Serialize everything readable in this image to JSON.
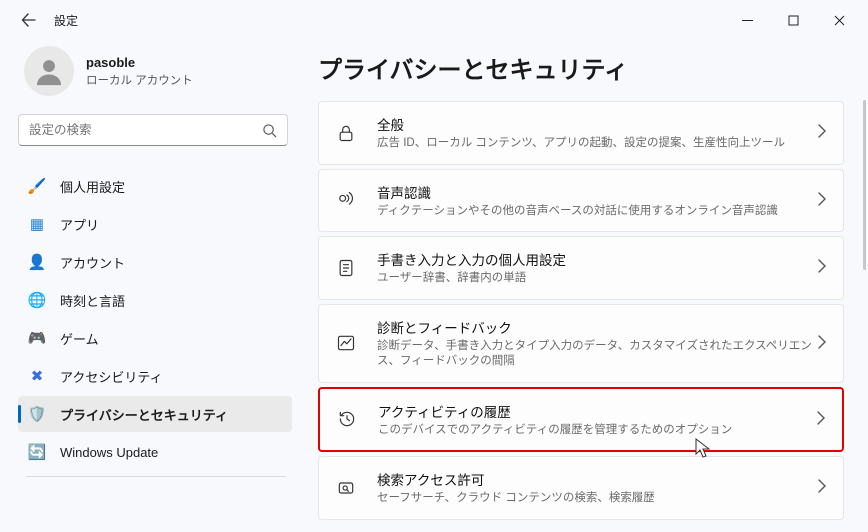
{
  "window": {
    "title": "設定"
  },
  "user": {
    "name": "pasoble",
    "type": "ローカル アカウント"
  },
  "search": {
    "placeholder": "設定の検索"
  },
  "nav": [
    {
      "icon": "🖌️",
      "label": "個人用設定"
    },
    {
      "icon": "▦",
      "label": "アプリ"
    },
    {
      "icon": "👤",
      "label": "アカウント"
    },
    {
      "icon": "🌐",
      "label": "時刻と言語"
    },
    {
      "icon": "🎮",
      "label": "ゲーム"
    },
    {
      "icon": "✖",
      "label": "アクセシビリティ"
    },
    {
      "icon": "🛡️",
      "label": "プライバシーとセキュリティ"
    },
    {
      "icon": "🔄",
      "label": "Windows Update"
    }
  ],
  "page": {
    "heading": "プライバシーとセキュリティ"
  },
  "items": [
    {
      "icon": "lock",
      "title": "全般",
      "desc": "広告 ID、ローカル コンテンツ、アプリの起動、設定の提案、生産性向上ツール"
    },
    {
      "icon": "voice",
      "title": "音声認識",
      "desc": "ディクテーションやその他の音声ベースの対話に使用するオンライン音声認識"
    },
    {
      "icon": "note",
      "title": "手書き入力と入力の個人用設定",
      "desc": "ユーザー辞書、辞書内の単語"
    },
    {
      "icon": "chart",
      "title": "診断とフィードバック",
      "desc": "診断データ、手書き入力とタイプ入力のデータ、カスタマイズされたエクスペリエンス、フィードバックの間隔"
    },
    {
      "icon": "history",
      "title": "アクティビティの履歴",
      "desc": "このデバイスでのアクティビティの履歴を管理するためのオプション",
      "highlight": true
    },
    {
      "icon": "search",
      "title": "検索アクセス許可",
      "desc": "セーフサーチ、クラウド コンテンツの検索、検索履歴"
    }
  ]
}
